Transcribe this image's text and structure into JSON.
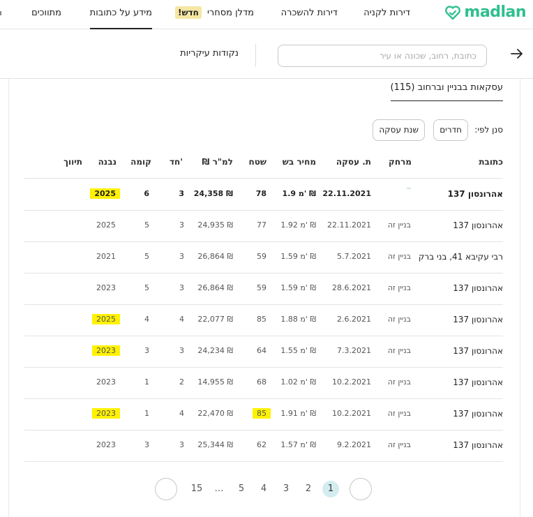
{
  "nav": {
    "brand": "madlan",
    "items": [
      {
        "label": "דירות לקניה"
      },
      {
        "label": "דירות להשכרה"
      },
      {
        "label": "מדלן מסחרי",
        "badge": "חדש!"
      },
      {
        "label": "מידע על כתובות",
        "active": true
      },
      {
        "label": "מתווכים"
      }
    ]
  },
  "search": {
    "placeholder": "כתובת, רחוב, שכונה או עיר",
    "value": "",
    "key_points": "נקודות עיקריות"
  },
  "section": {
    "title": "עסקאות בבניין וברחוב (115)",
    "sort_label": "סנן לפי:",
    "chips": [
      "חדרים",
      "שנת עסקה"
    ]
  },
  "table": {
    "headers": [
      "כתובת",
      "מרחק",
      "ת. עסקה",
      "מחיר בש",
      "שטח",
      "₪ למ\"ר",
      "חד'",
      "קומה",
      "נבנה",
      "תיווך"
    ],
    "rows": [
      {
        "address": "אהרונסון 137",
        "distance": "",
        "date": "22.11.2021",
        "price": "1.9 מ' ₪",
        "area": "78",
        "ppsm": "24,358 ₪",
        "rooms": "3",
        "floor": "6",
        "built": "2025",
        "bold": true,
        "hl_built": true,
        "hl_area": false
      },
      {
        "address": "אהרונסון 137",
        "distance": "בניין זה",
        "date": "22.11.2021",
        "price": "1.92 מ' ₪",
        "area": "77",
        "ppsm": "24,935 ₪",
        "rooms": "3",
        "floor": "5",
        "built": "2025",
        "bold": false,
        "hl_built": false,
        "hl_area": false
      },
      {
        "address": "רבי עקיבא 41, בני ברק",
        "distance": "בניין זה",
        "date": "5.7.2021",
        "price": "1.59 מ' ₪",
        "area": "59",
        "ppsm": "26,864 ₪",
        "rooms": "3",
        "floor": "5",
        "built": "2021",
        "bold": false,
        "hl_built": false,
        "hl_area": false
      },
      {
        "address": "אהרונסון 137",
        "distance": "בניין זה",
        "date": "28.6.2021",
        "price": "1.59 מ' ₪",
        "area": "59",
        "ppsm": "26,864 ₪",
        "rooms": "3",
        "floor": "5",
        "built": "2023",
        "bold": false,
        "hl_built": false,
        "hl_area": false
      },
      {
        "address": "אהרונסון 137",
        "distance": "בניין זה",
        "date": "2.6.2021",
        "price": "1.88 מ' ₪",
        "area": "85",
        "ppsm": "22,077 ₪",
        "rooms": "4",
        "floor": "4",
        "built": "2025",
        "bold": false,
        "hl_built": true,
        "hl_area": false
      },
      {
        "address": "אהרונסון 137",
        "distance": "בניין זה",
        "date": "7.3.2021",
        "price": "1.55 מ' ₪",
        "area": "64",
        "ppsm": "24,234 ₪",
        "rooms": "3",
        "floor": "3",
        "built": "2023",
        "bold": false,
        "hl_built": true,
        "hl_area": false
      },
      {
        "address": "אהרונסון 137",
        "distance": "בניין זה",
        "date": "10.2.2021",
        "price": "1.02 מ' ₪",
        "area": "68",
        "ppsm": "14,955 ₪",
        "rooms": "2",
        "floor": "1",
        "built": "2023",
        "bold": false,
        "hl_built": false,
        "hl_area": false
      },
      {
        "address": "אהרונסון 137",
        "distance": "בניין זה",
        "date": "10.2.2021",
        "price": "1.91 מ' ₪",
        "area": "85",
        "ppsm": "22,470 ₪",
        "rooms": "4",
        "floor": "1",
        "built": "2023",
        "bold": false,
        "hl_built": true,
        "hl_area": true
      },
      {
        "address": "אהרונסון 137",
        "distance": "בניין זה",
        "date": "9.2.2021",
        "price": "1.57 מ' ₪",
        "area": "62",
        "ppsm": "25,344 ₪",
        "rooms": "3",
        "floor": "3",
        "built": "2023",
        "bold": false,
        "hl_built": false,
        "hl_area": false
      }
    ]
  },
  "pagination": {
    "pages": [
      "1",
      "2",
      "3",
      "4",
      "5",
      "…",
      "15"
    ],
    "current": "1"
  },
  "colors": {
    "brand": "#2fbf8f",
    "highlight": "#fff200",
    "active_page": "#d3ecef",
    "new_badge": "#f5e6a3"
  },
  "icons": [
    "madlan-logo-icon",
    "arrow-right-icon"
  ]
}
